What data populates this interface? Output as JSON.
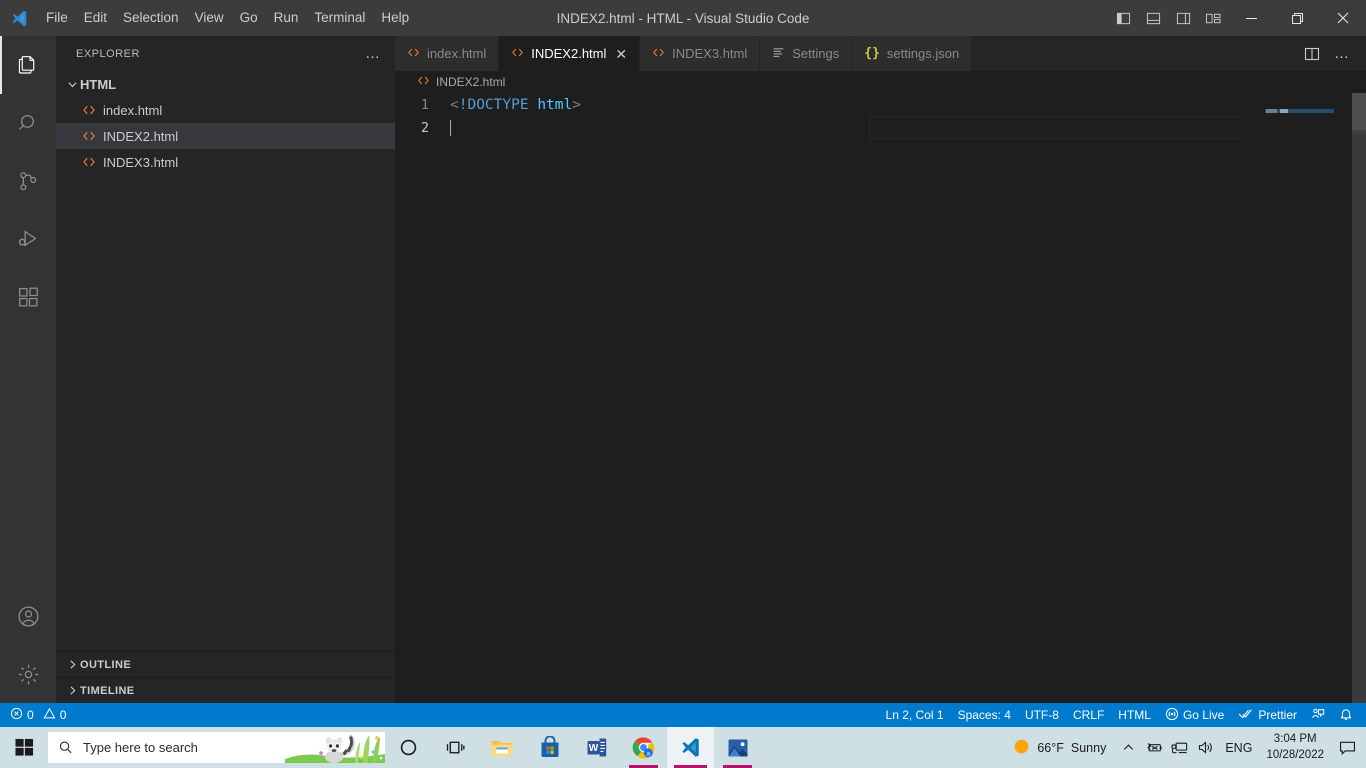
{
  "titlebar": {
    "app_icon": "vscode-logo-icon",
    "menus": [
      "File",
      "Edit",
      "Selection",
      "View",
      "Go",
      "Run",
      "Terminal",
      "Help"
    ],
    "window_title": "INDEX2.html - HTML - Visual Studio Code",
    "layout_buttons": [
      {
        "name": "toggle-primary-sidebar-icon",
        "label": "Toggle Primary Side Bar"
      },
      {
        "name": "toggle-panel-icon",
        "label": "Toggle Panel"
      },
      {
        "name": "toggle-secondary-sidebar-icon",
        "label": "Toggle Secondary Side Bar"
      },
      {
        "name": "customize-layout-icon",
        "label": "Customize Layout"
      }
    ],
    "window_controls": [
      {
        "name": "minimize-button",
        "glyph": "─"
      },
      {
        "name": "maximize-button",
        "glyph": "❐"
      },
      {
        "name": "close-button",
        "glyph": "✕"
      }
    ]
  },
  "activitybar": {
    "items": [
      {
        "name": "activity-explorer",
        "label": "Explorer",
        "active": true
      },
      {
        "name": "activity-search",
        "label": "Search",
        "active": false
      },
      {
        "name": "activity-source-control",
        "label": "Source Control",
        "active": false
      },
      {
        "name": "activity-run-debug",
        "label": "Run and Debug",
        "active": false
      },
      {
        "name": "activity-extensions",
        "label": "Extensions",
        "active": false
      }
    ],
    "bottom": [
      {
        "name": "activity-accounts",
        "label": "Accounts"
      },
      {
        "name": "activity-manage",
        "label": "Manage"
      }
    ]
  },
  "sidebar": {
    "header_title": "EXPLORER",
    "more_actions": "…",
    "folder": {
      "label": "HTML",
      "expanded": true
    },
    "files": [
      {
        "label": "index.html",
        "selected": false
      },
      {
        "label": "INDEX2.html",
        "selected": true
      },
      {
        "label": "INDEX3.html",
        "selected": false
      }
    ],
    "sections": [
      {
        "label": "OUTLINE",
        "expanded": false
      },
      {
        "label": "TIMELINE",
        "expanded": false
      }
    ]
  },
  "editor": {
    "tabs": [
      {
        "label": "index.html",
        "icon": "html-file-icon",
        "active": false,
        "closeable": false
      },
      {
        "label": "INDEX2.html",
        "icon": "html-file-icon",
        "active": true,
        "closeable": true,
        "close_glyph": "✕"
      },
      {
        "label": "INDEX3.html",
        "icon": "html-file-icon",
        "active": false,
        "closeable": false
      },
      {
        "label": "Settings",
        "icon": "settings-list-icon",
        "active": false,
        "closeable": false
      },
      {
        "label": "settings.json",
        "icon": "json-braces-icon",
        "active": false,
        "closeable": false
      }
    ],
    "actions": [
      {
        "name": "split-editor-right-button",
        "label": "Split Editor Right"
      },
      {
        "name": "more-editor-actions-button",
        "label": "More Actions..."
      }
    ],
    "breadcrumb": {
      "icon": "html-file-icon",
      "label": "INDEX2.html"
    },
    "lines": [
      {
        "number": "1",
        "active": false,
        "tokens": [
          {
            "text": "<",
            "cls": "tk-gray"
          },
          {
            "text": "!DOCTYPE",
            "cls": "tk-lblue"
          },
          {
            "text": " ",
            "cls": "tk-gray"
          },
          {
            "text": "html",
            "cls": "tk-blue"
          },
          {
            "text": ">",
            "cls": "tk-gray"
          }
        ]
      },
      {
        "number": "2",
        "active": true,
        "tokens": []
      }
    ]
  },
  "statusbar": {
    "left": [
      {
        "name": "status-problems",
        "icon": "error-circle-icon",
        "errors": "0",
        "warn_icon": "warning-triangle-icon",
        "warnings": "0"
      }
    ],
    "right": [
      {
        "name": "status-cursor-position",
        "label": "Ln 2, Col 1"
      },
      {
        "name": "status-indentation",
        "label": "Spaces: 4"
      },
      {
        "name": "status-encoding",
        "label": "UTF-8"
      },
      {
        "name": "status-eol",
        "label": "CRLF"
      },
      {
        "name": "status-language-mode",
        "label": "HTML"
      },
      {
        "name": "status-go-live",
        "label": "Go Live",
        "icon": "broadcast-icon"
      },
      {
        "name": "status-prettier",
        "label": "Prettier",
        "icon": "double-check-icon"
      },
      {
        "name": "status-feedback",
        "label": "",
        "icon": "feedback-person-icon"
      },
      {
        "name": "status-notifications",
        "label": "",
        "icon": "bell-icon"
      }
    ]
  },
  "taskbar": {
    "start_button": "windows-start-icon",
    "search": {
      "placeholder": "Type here to search",
      "icon": "search-icon",
      "illustration": "lemur-illustration"
    },
    "icons": [
      {
        "name": "taskbar-cortana",
        "label": "Cortana",
        "state": "idle"
      },
      {
        "name": "taskbar-task-view",
        "label": "Task View",
        "state": "idle"
      },
      {
        "name": "taskbar-file-explorer",
        "label": "File Explorer",
        "state": "idle"
      },
      {
        "name": "taskbar-microsoft-store",
        "label": "Microsoft Store",
        "state": "idle"
      },
      {
        "name": "taskbar-word",
        "label": "Word",
        "state": "idle"
      },
      {
        "name": "taskbar-chrome",
        "label": "Google Chrome",
        "state": "running"
      },
      {
        "name": "taskbar-vscode",
        "label": "Visual Studio Code",
        "state": "active"
      },
      {
        "name": "taskbar-photos",
        "label": "Photos",
        "state": "running"
      }
    ],
    "tray": {
      "weather_temp": "66°F",
      "weather_desc": "Sunny",
      "chevron": "∧",
      "icons": [
        {
          "name": "tray-battery-icon",
          "label": "Battery"
        },
        {
          "name": "tray-network-icon",
          "label": "Network"
        },
        {
          "name": "tray-volume-icon",
          "label": "Volume"
        }
      ],
      "language": "ENG",
      "time": "3:04 PM",
      "date": "10/28/2022",
      "action_center": "action-center-icon"
    }
  },
  "colors": {
    "titlebar_bg": "#3c3c3c",
    "activitybar_bg": "#333333",
    "sidebar_bg": "#252526",
    "editor_bg": "#1e1e1e",
    "tab_active_bg": "#1e1e1e",
    "tab_inactive_bg": "#2d2d2d",
    "statusbar_bg": "#007acc",
    "taskbar_bg": "#cfe0e4",
    "html_icon_orange": "#e37933",
    "accent_blue": "#0078d4",
    "selection_row": "#37373d"
  }
}
